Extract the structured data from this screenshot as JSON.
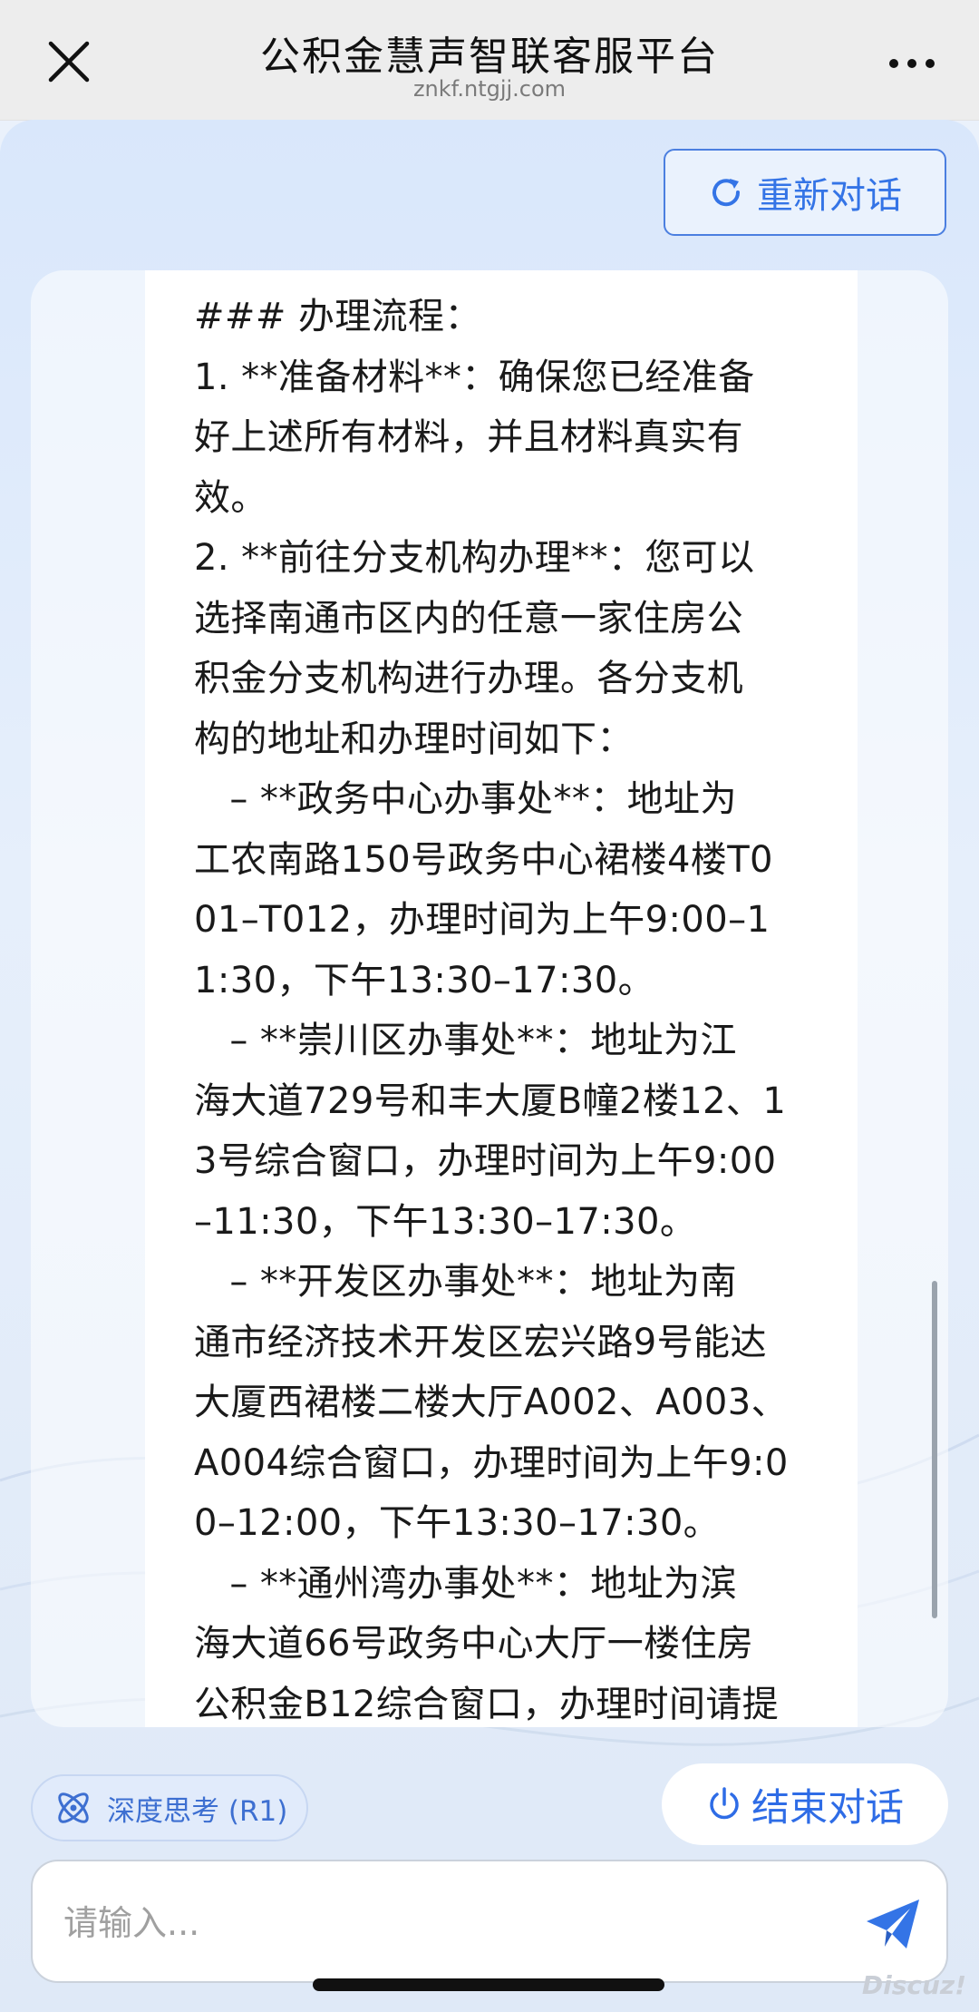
{
  "topbar": {
    "title": "公积金慧声智联客服平台",
    "subtitle": "znkf.ntgjj.com",
    "close_icon": "close-icon",
    "more_icon": "more-icon"
  },
  "restart": {
    "label": "重新对话",
    "icon": "refresh-icon"
  },
  "message": {
    "lines": [
      "### 办理流程：",
      "1. **准备材料**：确保您已经准备",
      "好上述所有材料，并且材料真实有",
      "效。",
      "2. **前往分支机构办理**：您可以",
      "选择南通市区内的任意一家住房公",
      "积金分支机构进行办理。各分支机",
      "构的地址和办理时间如下：",
      "   – **政务中心办事处**：地址为",
      "工农南路150号政务中心裙楼4楼T0",
      "01–T012，办理时间为上午9:00–1",
      "1:30，下午13:30–17:30。",
      "   – **崇川区办事处**：地址为江",
      "海大道729号和丰大厦B幢2楼12、1",
      "3号综合窗口，办理时间为上午9:00",
      "–11:30，下午13:30–17:30。",
      "   – **开发区办事处**：地址为南",
      "通市经济技术开发区宏兴路9号能达",
      "大厦西裙楼二楼大厅A002、A003、",
      "A004综合窗口，办理时间为上午9:0",
      "0–12:00，下午13:30–17:30。",
      "   – **通州湾办事处**：地址为滨",
      "海大道66号政务中心大厅一楼住房",
      "公积金B12综合窗口，办理时间请提"
    ]
  },
  "deep_think": {
    "label": "深度思考 (R1)",
    "icon": "atom-icon"
  },
  "end_chat": {
    "label": "结束对话",
    "icon": "power-icon"
  },
  "input": {
    "placeholder": "请输入...",
    "value": ""
  },
  "send": {
    "icon": "send-icon"
  },
  "watermark": "Discuz!",
  "colors": {
    "accent": "#3474e6",
    "background": "#e6effb",
    "topbar": "#ededed"
  }
}
